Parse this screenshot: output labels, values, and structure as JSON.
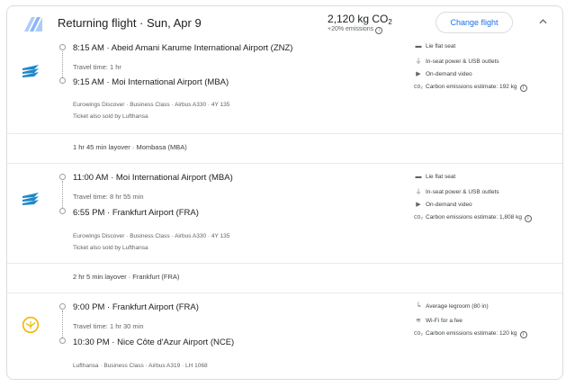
{
  "header": {
    "title": "Returning flight · Sun, Apr 9",
    "co2_value": "2,120 kg CO",
    "co2_sub": "2",
    "emissions_note": "+20% emissions",
    "change_button": "Change flight",
    "collapse_icon": "chevron-up-icon"
  },
  "segments": [
    {
      "airline_icon": "eurowings-logo-icon",
      "depart": "8:15 AM · Abeid Amani Karume International Airport (ZNZ)",
      "travel_time": "Travel time: 1 hr",
      "arrive": "9:15 AM · Moi International Airport (MBA)",
      "details": "Eurowings Discover · Business Class · Airbus A330 · 4Y 135",
      "sold_by": "Ticket also sold by Lufthansa",
      "amenities": [
        {
          "icon": "seat-icon",
          "label": "Lie flat seat"
        },
        {
          "icon": "power-icon",
          "label": "In-seat power & USB outlets"
        },
        {
          "icon": "video-icon",
          "label": "On-demand video"
        },
        {
          "icon": "co2-icon",
          "label": "Carbon emissions estimate: 192 kg"
        }
      ]
    },
    {
      "airline_icon": "eurowings-logo-icon",
      "depart": "11:00 AM · Moi International Airport (MBA)",
      "travel_time": "Travel time: 8 hr 55 min",
      "arrive": "6:55 PM · Frankfurt Airport (FRA)",
      "details": "Eurowings Discover · Business Class · Airbus A330 · 4Y 135",
      "sold_by": "Ticket also sold by Lufthansa",
      "amenities": [
        {
          "icon": "seat-icon",
          "label": "Lie flat seat"
        },
        {
          "icon": "power-icon",
          "label": "In-seat power & USB outlets"
        },
        {
          "icon": "video-icon",
          "label": "On-demand video"
        },
        {
          "icon": "co2-icon",
          "label": "Carbon emissions estimate: 1,808 kg"
        }
      ]
    },
    {
      "airline_icon": "lufthansa-logo-icon",
      "depart": "9:00 PM · Frankfurt Airport (FRA)",
      "travel_time": "Travel time: 1 hr 30 min",
      "arrive": "10:30 PM · Nice Côte d'Azur Airport (NCE)",
      "details": "Lufthansa · Business Class · Airbus A319 · LH 1068",
      "amenities": [
        {
          "icon": "legroom-icon",
          "label": "Average legroom (80 in)"
        },
        {
          "icon": "wifi-icon",
          "label": "Wi-Fi for a fee"
        },
        {
          "icon": "co2-icon",
          "label": "Carbon emissions estimate: 120 kg"
        }
      ]
    }
  ],
  "layovers": [
    {
      "label": "1 hr 45 min layover · Mombasa (MBA)"
    },
    {
      "label": "2 hr 5 min layover · Frankfurt (FRA)"
    }
  ],
  "colors": {
    "accent": "#1a73e8",
    "eurowings": "#1e88c8",
    "lufthansa": "#f5b800"
  }
}
